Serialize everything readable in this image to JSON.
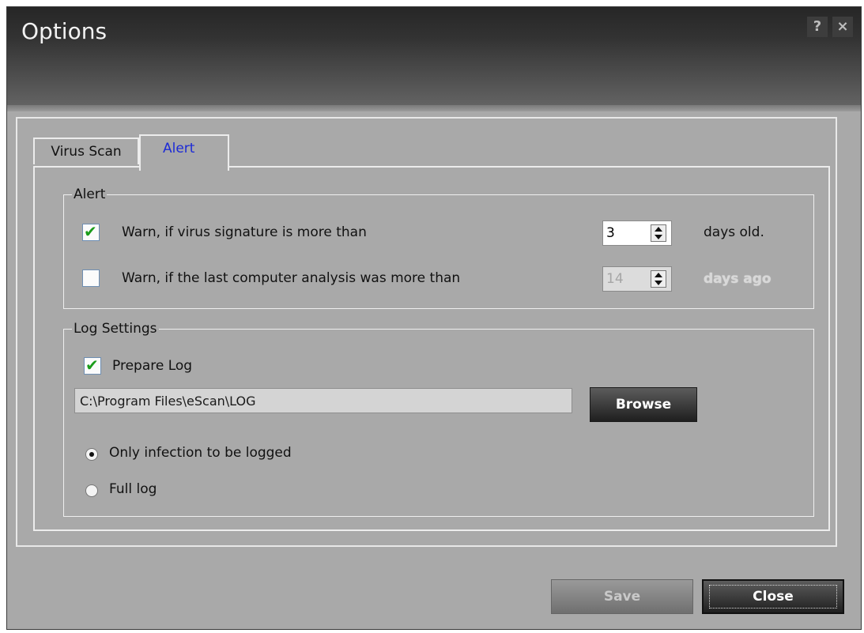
{
  "window": {
    "title": "Options",
    "help_glyph": "?",
    "close_glyph": "×"
  },
  "tabs": [
    {
      "label": "Virus Scan"
    },
    {
      "label": "Alert",
      "active": true
    }
  ],
  "alert": {
    "group_label": "Alert",
    "rows": [
      {
        "label": "Warn, if virus signature is more than",
        "checked": true,
        "value": "3",
        "suffix": "days old.",
        "enabled": true
      },
      {
        "label": "Warn, if the last computer analysis was more than",
        "checked": false,
        "value": "14",
        "suffix": "days ago",
        "enabled": false
      }
    ]
  },
  "log": {
    "group_label": "Log Settings",
    "prepare_label": "Prepare Log",
    "prepare_checked": true,
    "path_value": "C:\\Program Files\\eScan\\LOG",
    "browse_label": "Browse",
    "radios": [
      {
        "label": "Only infection to be logged",
        "selected": true
      },
      {
        "label": "Full log",
        "selected": false
      }
    ]
  },
  "footer": {
    "save_label": "Save",
    "close_label": "Close"
  },
  "colors": {
    "checkmark": "#1a9c1a",
    "active_tab_text": "#1d2bd6"
  },
  "icons": {
    "checkbox_mark": "check-icon",
    "help": "help-icon",
    "close": "close-icon"
  }
}
